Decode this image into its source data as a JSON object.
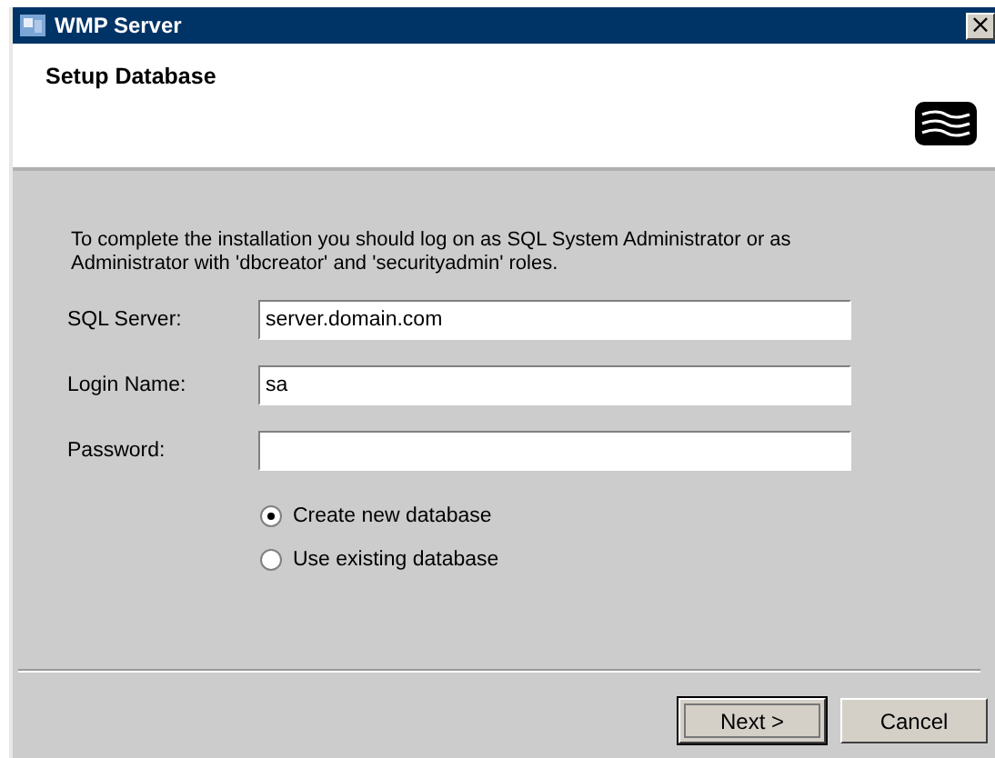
{
  "window": {
    "title": "WMP Server",
    "close": "×"
  },
  "header": {
    "title": "Setup Database"
  },
  "intro": "To complete the installation you should log on as SQL System Administrator or as Administrator with 'dbcreator' and 'securityadmin' roles.",
  "fields": [
    {
      "label": "SQL Server:",
      "value": "server.domain.com"
    },
    {
      "label": "Login Name:",
      "value": "sa"
    },
    {
      "label": "Password:"
    }
  ],
  "options": [
    {
      "label": "Create new database",
      "selected": true
    },
    {
      "label": "Use existing database",
      "selected": false
    }
  ],
  "buttons": [
    {
      "label": "Next >",
      "focused": true
    },
    {
      "label": "Cancel",
      "focused": false
    }
  ]
}
